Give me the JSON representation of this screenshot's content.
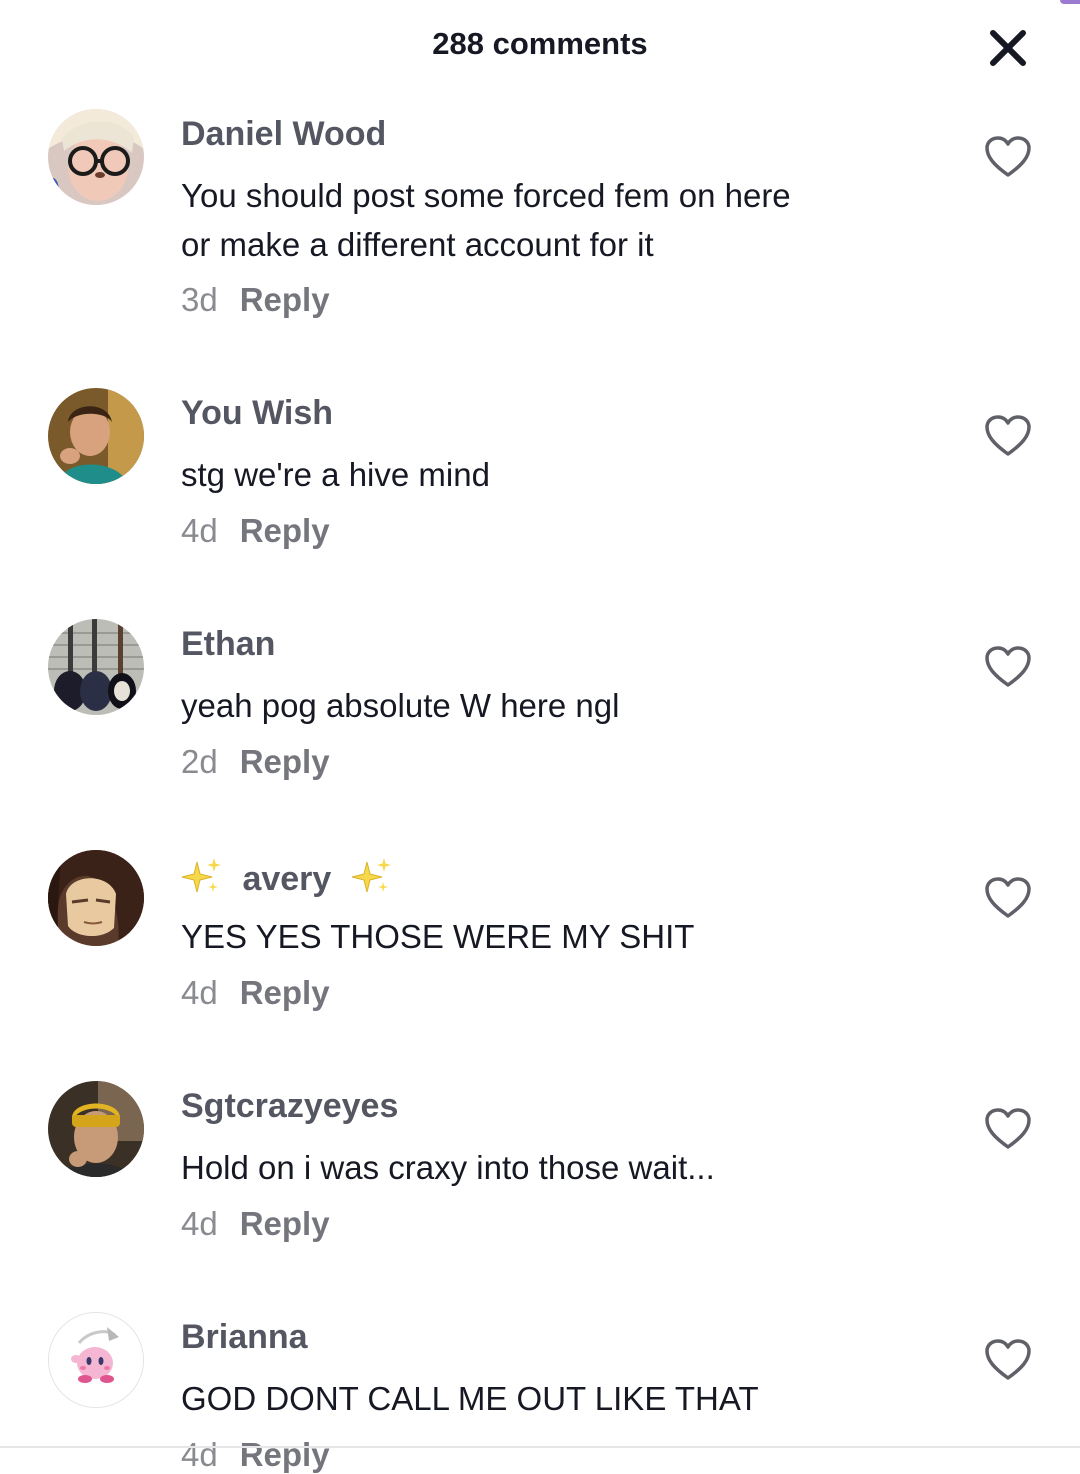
{
  "header": {
    "title": "288 comments",
    "close_icon": "close-icon"
  },
  "comments": [
    {
      "username": "Daniel Wood",
      "text": "You should post some forced fem on here\nor make a different account for it",
      "age": "3d",
      "reply_label": "Reply",
      "avatar": "avatar-glasses"
    },
    {
      "username": "You Wish",
      "text": "stg we're a hive mind",
      "age": "4d",
      "reply_label": "Reply",
      "avatar": "avatar-selfie"
    },
    {
      "username": "Ethan",
      "text": "yeah pog absolute W here ngl",
      "age": "2d",
      "reply_label": "Reply",
      "avatar": "avatar-guitars"
    },
    {
      "username": "avery",
      "text": "YES YES THOSE WERE MY SHIT",
      "age": "4d",
      "reply_label": "Reply",
      "avatar": "avatar-anime",
      "name_decoration": "sparkles-icon"
    },
    {
      "username": "Sgtcrazyeyes",
      "text": "Hold on i was craxy into those wait...",
      "age": "4d",
      "reply_label": "Reply",
      "avatar": "avatar-beanie"
    },
    {
      "username": "Brianna",
      "text": "GOD DONT CALL ME OUT LIKE THAT",
      "age": "4d",
      "reply_label": "Reply",
      "avatar": "avatar-kirby"
    }
  ],
  "colors": {
    "text": "#161823",
    "username": "#545661",
    "meta": "#8a8b91",
    "heart_outline": "#5f6068"
  }
}
